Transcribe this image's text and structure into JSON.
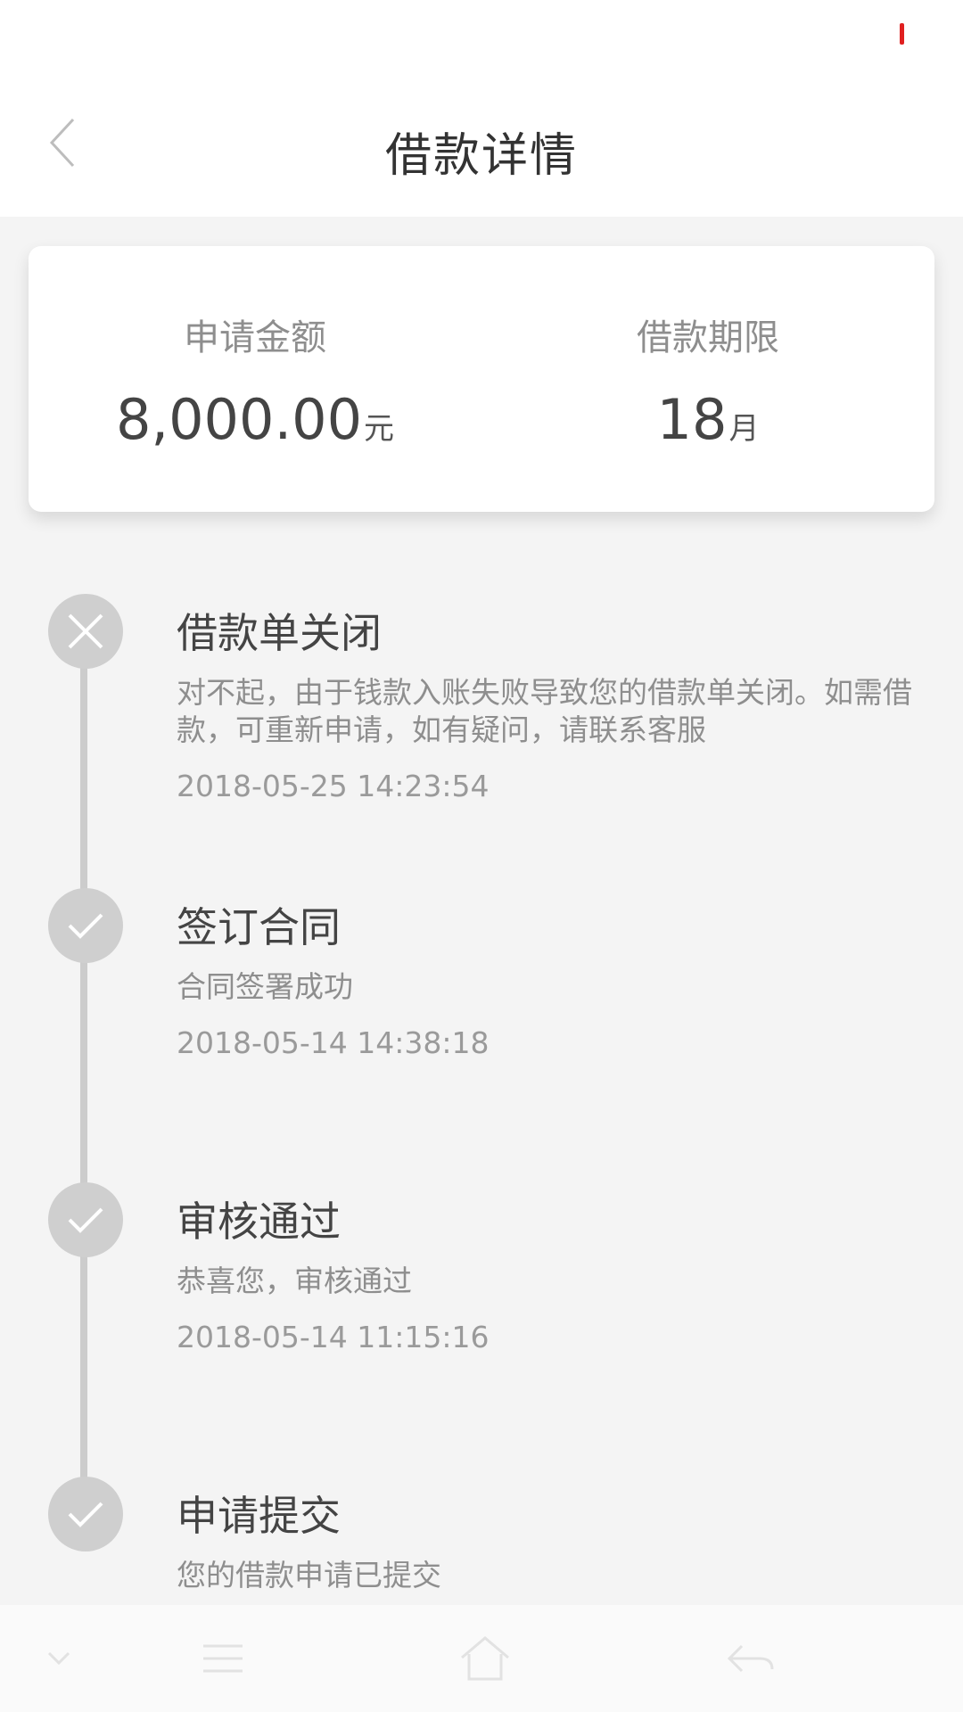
{
  "header": {
    "title": "借款详情",
    "back_icon": "chevron-left-icon"
  },
  "summary": {
    "amount_label": "申请金额",
    "amount_value": "8,000.00",
    "amount_unit": "元",
    "term_label": "借款期限",
    "term_value": "18",
    "term_unit": "月"
  },
  "timeline": [
    {
      "status_icon": "close-icon",
      "title": "借款单关闭",
      "desc": "对不起，由于钱款入账失败导致您的借款单关闭。如需借款，可重新申请，如有疑问，请联系客服",
      "time": "2018-05-25 14:23:54"
    },
    {
      "status_icon": "check-icon",
      "title": "签订合同",
      "desc": "合同签署成功",
      "time": "2018-05-14 14:38:18"
    },
    {
      "status_icon": "check-icon",
      "title": "审核通过",
      "desc": "恭喜您，审核通过",
      "time": "2018-05-14 11:15:16"
    },
    {
      "status_icon": "check-icon",
      "title": "申请提交",
      "desc": "您的借款申请已提交"
    }
  ],
  "colors": {
    "background": "#f4f4f4",
    "card": "#ffffff",
    "node": "#cfcfcf",
    "line": "#cccccc",
    "status_indicator": "#e02020"
  }
}
